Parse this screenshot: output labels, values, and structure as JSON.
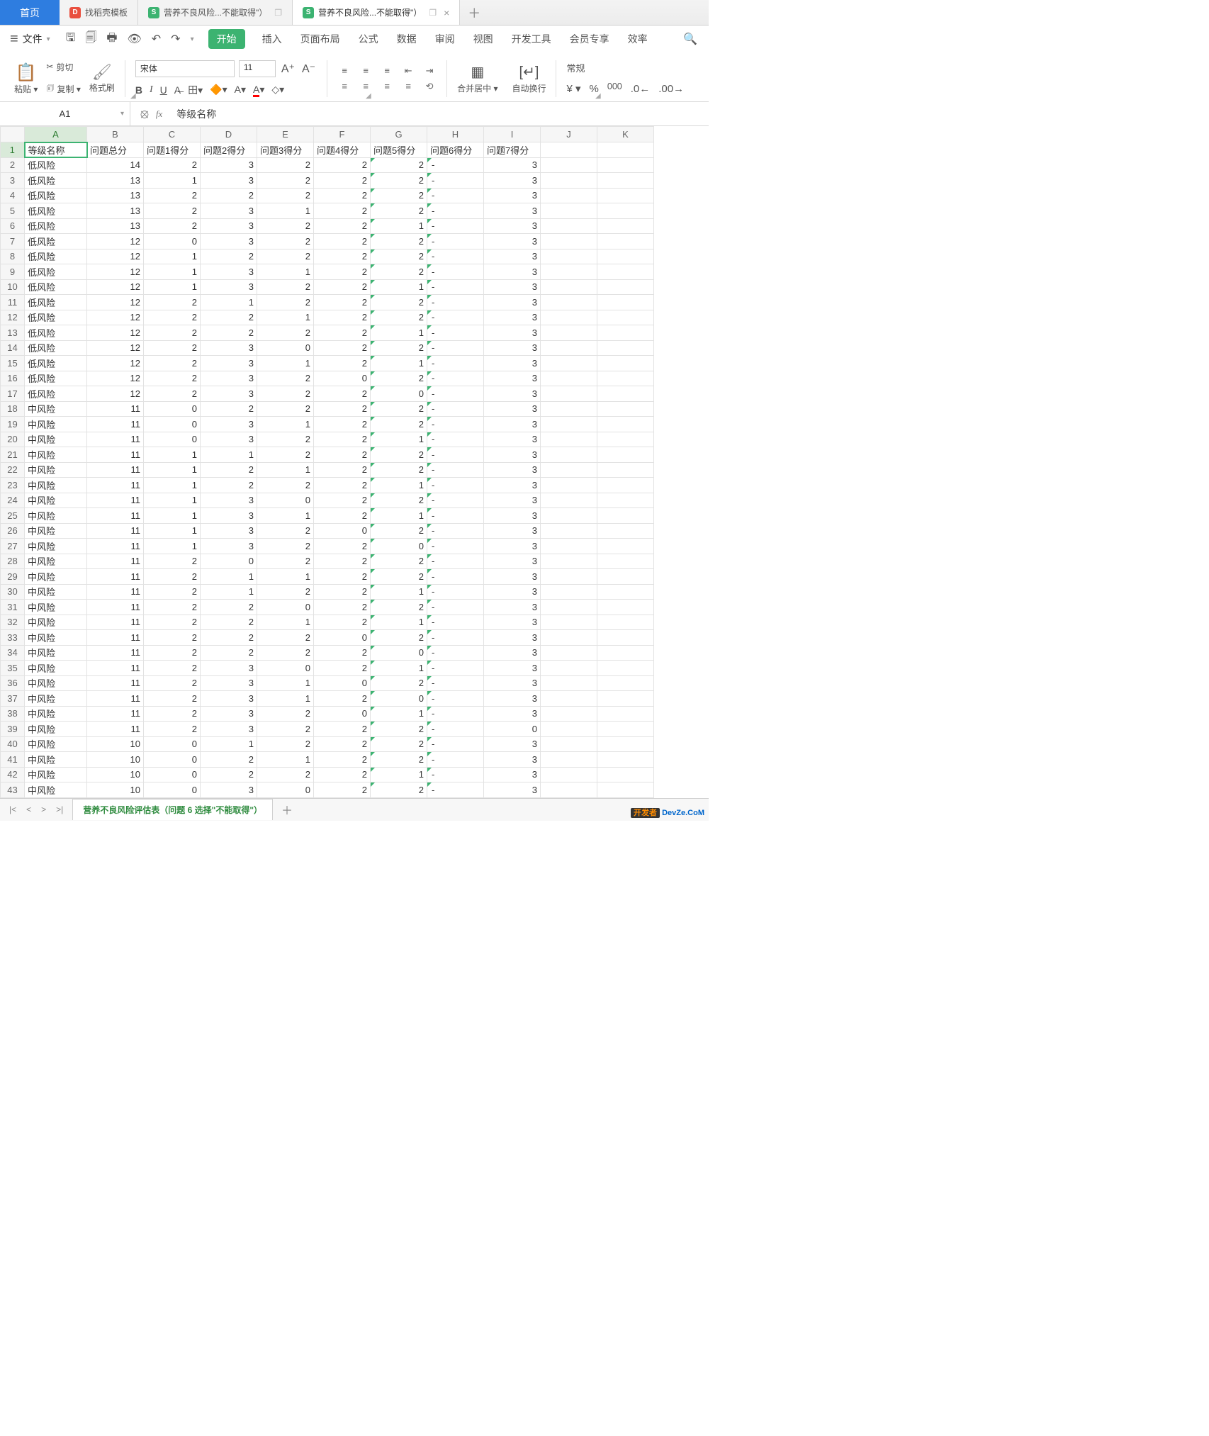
{
  "tabs": {
    "home": "首页",
    "t1": "找稻壳模板",
    "t2": "营养不良风险...不能取得\"）",
    "t3": "营养不良风险...不能取得\"）"
  },
  "menu": {
    "file": "文件",
    "items": [
      "开始",
      "插入",
      "页面布局",
      "公式",
      "数据",
      "审阅",
      "视图",
      "开发工具",
      "会员专享",
      "效率"
    ]
  },
  "toolbar": {
    "paste": "粘贴 ▾",
    "cut": "剪切",
    "copy": "复制 ▾",
    "format_painter": "格式刷",
    "font_name": "宋体",
    "font_size": "11",
    "merge": "合并居中 ▾",
    "wrap": "自动换行",
    "num_format": "常规"
  },
  "namebox": "A1",
  "formula": "等级名称",
  "columns": [
    "A",
    "B",
    "C",
    "D",
    "E",
    "F",
    "G",
    "H",
    "I",
    "J",
    "K"
  ],
  "headers_row": [
    "等级名称",
    "问题总分",
    "问题1得分",
    "问题2得分",
    "问题3得分",
    "问题4得分",
    "问题5得分",
    "问题6得分",
    "问题7得分",
    "",
    ""
  ],
  "rows": [
    [
      "低风险",
      14,
      2,
      3,
      2,
      2,
      2,
      "-",
      3
    ],
    [
      "低风险",
      13,
      1,
      3,
      2,
      2,
      2,
      "-",
      3
    ],
    [
      "低风险",
      13,
      2,
      2,
      2,
      2,
      2,
      "-",
      3
    ],
    [
      "低风险",
      13,
      2,
      3,
      1,
      2,
      2,
      "-",
      3
    ],
    [
      "低风险",
      13,
      2,
      3,
      2,
      2,
      1,
      "-",
      3
    ],
    [
      "低风险",
      12,
      0,
      3,
      2,
      2,
      2,
      "-",
      3
    ],
    [
      "低风险",
      12,
      1,
      2,
      2,
      2,
      2,
      "-",
      3
    ],
    [
      "低风险",
      12,
      1,
      3,
      1,
      2,
      2,
      "-",
      3
    ],
    [
      "低风险",
      12,
      1,
      3,
      2,
      2,
      1,
      "-",
      3
    ],
    [
      "低风险",
      12,
      2,
      1,
      2,
      2,
      2,
      "-",
      3
    ],
    [
      "低风险",
      12,
      2,
      2,
      1,
      2,
      2,
      "-",
      3
    ],
    [
      "低风险",
      12,
      2,
      2,
      2,
      2,
      1,
      "-",
      3
    ],
    [
      "低风险",
      12,
      2,
      3,
      0,
      2,
      2,
      "-",
      3
    ],
    [
      "低风险",
      12,
      2,
      3,
      1,
      2,
      1,
      "-",
      3
    ],
    [
      "低风险",
      12,
      2,
      3,
      2,
      0,
      2,
      "-",
      3
    ],
    [
      "低风险",
      12,
      2,
      3,
      2,
      2,
      0,
      "-",
      3
    ],
    [
      "中风险",
      11,
      0,
      2,
      2,
      2,
      2,
      "-",
      3
    ],
    [
      "中风险",
      11,
      0,
      3,
      1,
      2,
      2,
      "-",
      3
    ],
    [
      "中风险",
      11,
      0,
      3,
      2,
      2,
      1,
      "-",
      3
    ],
    [
      "中风险",
      11,
      1,
      1,
      2,
      2,
      2,
      "-",
      3
    ],
    [
      "中风险",
      11,
      1,
      2,
      1,
      2,
      2,
      "-",
      3
    ],
    [
      "中风险",
      11,
      1,
      2,
      2,
      2,
      1,
      "-",
      3
    ],
    [
      "中风险",
      11,
      1,
      3,
      0,
      2,
      2,
      "-",
      3
    ],
    [
      "中风险",
      11,
      1,
      3,
      1,
      2,
      1,
      "-",
      3
    ],
    [
      "中风险",
      11,
      1,
      3,
      2,
      0,
      2,
      "-",
      3
    ],
    [
      "中风险",
      11,
      1,
      3,
      2,
      2,
      0,
      "-",
      3
    ],
    [
      "中风险",
      11,
      2,
      0,
      2,
      2,
      2,
      "-",
      3
    ],
    [
      "中风险",
      11,
      2,
      1,
      1,
      2,
      2,
      "-",
      3
    ],
    [
      "中风险",
      11,
      2,
      1,
      2,
      2,
      1,
      "-",
      3
    ],
    [
      "中风险",
      11,
      2,
      2,
      0,
      2,
      2,
      "-",
      3
    ],
    [
      "中风险",
      11,
      2,
      2,
      1,
      2,
      1,
      "-",
      3
    ],
    [
      "中风险",
      11,
      2,
      2,
      2,
      0,
      2,
      "-",
      3
    ],
    [
      "中风险",
      11,
      2,
      2,
      2,
      2,
      0,
      "-",
      3
    ],
    [
      "中风险",
      11,
      2,
      3,
      0,
      2,
      1,
      "-",
      3
    ],
    [
      "中风险",
      11,
      2,
      3,
      1,
      0,
      2,
      "-",
      3
    ],
    [
      "中风险",
      11,
      2,
      3,
      1,
      2,
      0,
      "-",
      3
    ],
    [
      "中风险",
      11,
      2,
      3,
      2,
      0,
      1,
      "-",
      3
    ],
    [
      "中风险",
      11,
      2,
      3,
      2,
      2,
      2,
      "-",
      0
    ],
    [
      "中风险",
      10,
      0,
      1,
      2,
      2,
      2,
      "-",
      3
    ],
    [
      "中风险",
      10,
      0,
      2,
      1,
      2,
      2,
      "-",
      3
    ],
    [
      "中风险",
      10,
      0,
      2,
      2,
      2,
      1,
      "-",
      3
    ],
    [
      "中风险",
      10,
      0,
      3,
      0,
      2,
      2,
      "-",
      3
    ]
  ],
  "sheet_tab": "营养不良风险评估表（问题 6 选择\"不能取得\"）",
  "watermark": {
    "brand": "开发者",
    "url": "DevZe.CoM"
  }
}
